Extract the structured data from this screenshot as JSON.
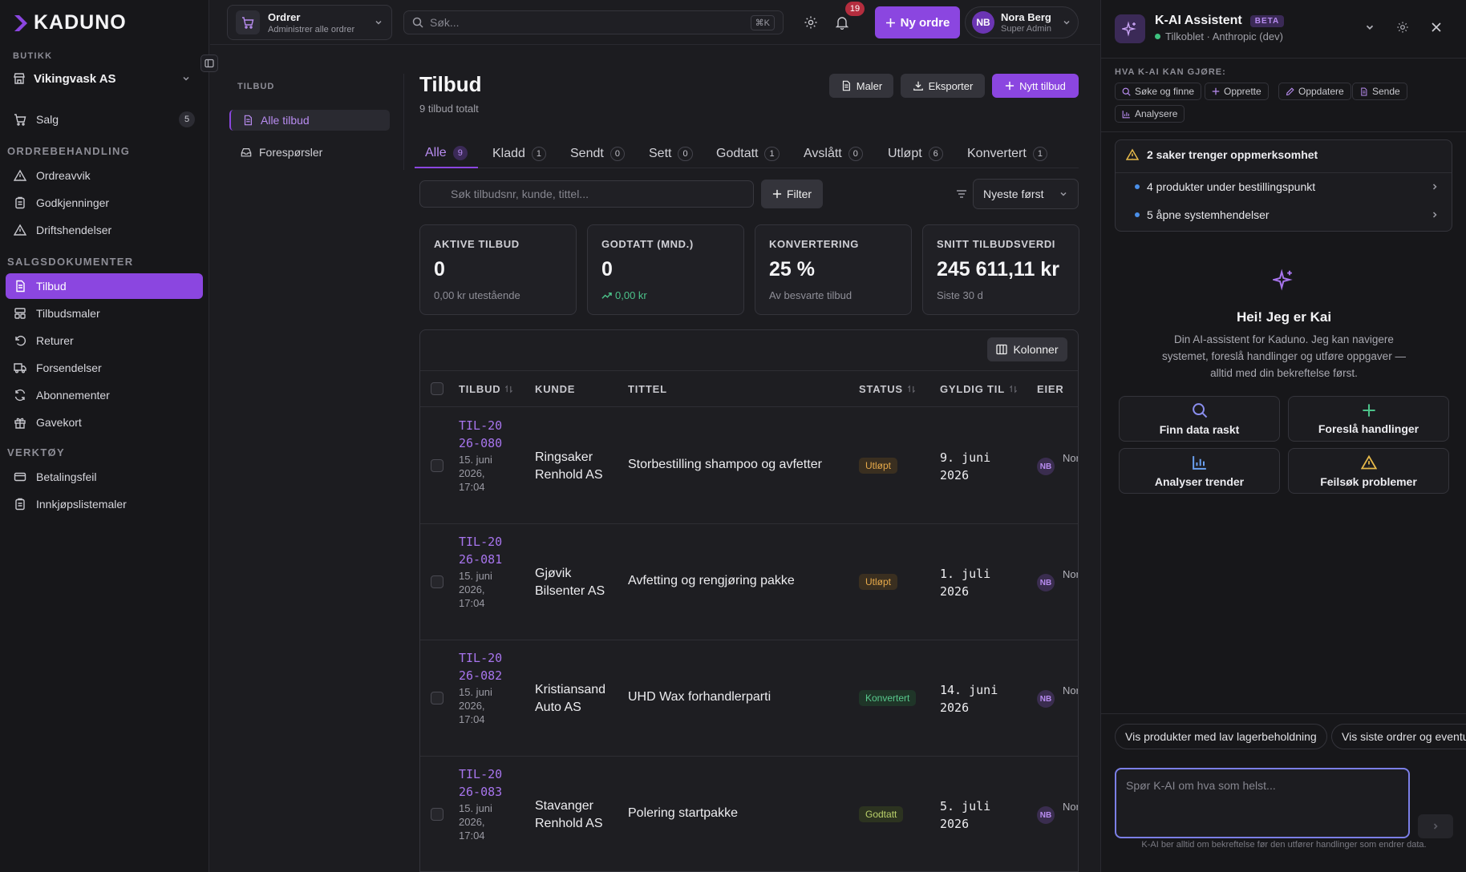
{
  "app": {
    "logo": "KADUNO"
  },
  "sidebar": {
    "shop_label": "BUTIKK",
    "shop_name": "Vikingvask AS",
    "sales": {
      "label": "Salg",
      "count": "5"
    },
    "sections": [
      {
        "label": "ORDREBEHANDLING",
        "items": [
          "Ordreavvik",
          "Godkjenninger",
          "Driftshendelser"
        ]
      },
      {
        "label": "SALGSDOKUMENTER",
        "items": [
          "Tilbud",
          "Tilbudsmaler",
          "Returer",
          "Forsendelser",
          "Abonnementer",
          "Gavekort"
        ]
      },
      {
        "label": "VERKTØY",
        "items": [
          "Betalingsfeil",
          "Innkjøpslistemaler"
        ]
      }
    ],
    "active_item": "Tilbud"
  },
  "topbar": {
    "module_title": "Ordrer",
    "module_sub": "Administrer alle ordrer",
    "search_placeholder": "Søk...",
    "search_kbd": "⌘K",
    "notif_count": "19",
    "new_order_label": "Ny ordre",
    "user": {
      "initials": "NB",
      "name": "Nora Berg",
      "role": "Super Admin"
    }
  },
  "subnav": {
    "label": "TILBUD",
    "items": [
      "Alle tilbud",
      "Forespørsler"
    ]
  },
  "main": {
    "title": "Tilbud",
    "subtitle": "9 tilbud totalt",
    "buttons": {
      "templates": "Maler",
      "export": "Eksporter",
      "new_offer": "Nytt tilbud"
    },
    "tabs": [
      {
        "label": "Alle",
        "count": "9"
      },
      {
        "label": "Kladd",
        "count": "1"
      },
      {
        "label": "Sendt",
        "count": "0"
      },
      {
        "label": "Sett",
        "count": "0"
      },
      {
        "label": "Godtatt",
        "count": "1"
      },
      {
        "label": "Avslått",
        "count": "0"
      },
      {
        "label": "Utløpt",
        "count": "6"
      },
      {
        "label": "Konvertert",
        "count": "1"
      }
    ],
    "search_placeholder": "Søk tilbudsnr, kunde, tittel...",
    "filter_label": "Filter",
    "sort_label": "Nyeste først",
    "cards": [
      {
        "label": "AKTIVE TILBUD",
        "value": "0",
        "sub": "0,00 kr utestående"
      },
      {
        "label": "GODTATT (MND.)",
        "value": "0",
        "sub": "0,00 kr"
      },
      {
        "label": "KONVERTERING",
        "value": "25 %",
        "sub": "Av besvarte tilbud"
      },
      {
        "label": "SNITT TILBUDSVERDI",
        "value": "245 611,11 kr",
        "sub": "Siste 30 d"
      }
    ],
    "columns_button": "Kolonner",
    "table": {
      "headers": [
        "TILBUD",
        "KUNDE",
        "TITTEL",
        "STATUS",
        "GYLDIG TIL",
        "EIER"
      ],
      "rows": [
        {
          "id": "TIL-2026-080",
          "created": "15. juni 2026, 17:04",
          "customer": "Ringsaker Renhold AS",
          "title": "Storbestilling shampoo og avfetter",
          "status": "Utløpt",
          "valid": "9. juni 2026",
          "owner_initials": "NB",
          "owner_name": "Nora Berg"
        },
        {
          "id": "TIL-2026-081",
          "created": "15. juni 2026, 17:04",
          "customer": "Gjøvik Bilsenter AS",
          "title": "Avfetting og rengjøring pakke",
          "status": "Utløpt",
          "valid": "1. juli 2026",
          "owner_initials": "NB",
          "owner_name": "Nora Berg"
        },
        {
          "id": "TIL-2026-082",
          "created": "15. juni 2026, 17:04",
          "customer": "Kristiansand Auto AS",
          "title": "UHD Wax forhandlerparti",
          "status": "Konvertert",
          "valid": "14. juni 2026",
          "owner_initials": "NB",
          "owner_name": "Nora Berg"
        },
        {
          "id": "TIL-2026-083",
          "created": "15. juni 2026, 17:04",
          "customer": "Stavanger Renhold AS",
          "title": "Polering startpakke",
          "status": "Godtatt",
          "valid": "5. juli 2026",
          "owner_initials": "NB",
          "owner_name": "Nora Berg"
        }
      ]
    }
  },
  "ai": {
    "title": "K-AI Assistent",
    "beta": "BETA",
    "status": "Tilkoblet · Anthropic (dev)",
    "can_label": "HVA K-AI KAN GJØRE:",
    "capabilities": [
      "Søke og finne",
      "Opprette",
      "Oppdatere",
      "Sende",
      "Analysere"
    ],
    "attention_title": "2 saker trenger oppmerksomhet",
    "attention_items": [
      "4 produkter under bestillingspunkt",
      "5 åpne systemhendelser"
    ],
    "hello_title": "Hei! Jeg er Kai",
    "hello_text": "Din AI-assistent for Kaduno. Jeg kan navigere systemet, foreslå handlinger og utføre oppgaver — alltid med din bekreftelse først.",
    "quick_actions": [
      "Finn data raskt",
      "Foreslå handlinger",
      "Analyser trender",
      "Feilsøk problemer"
    ],
    "suggestions": [
      "Vis produkter med lav lagerbeholdning",
      "Vis siste ordrer og eventuelle avvik"
    ],
    "input_placeholder": "Spør K-AI om hva som helst...",
    "disclaimer": "K-AI ber alltid om bekreftelse før den utfører handlinger som endrer data."
  }
}
